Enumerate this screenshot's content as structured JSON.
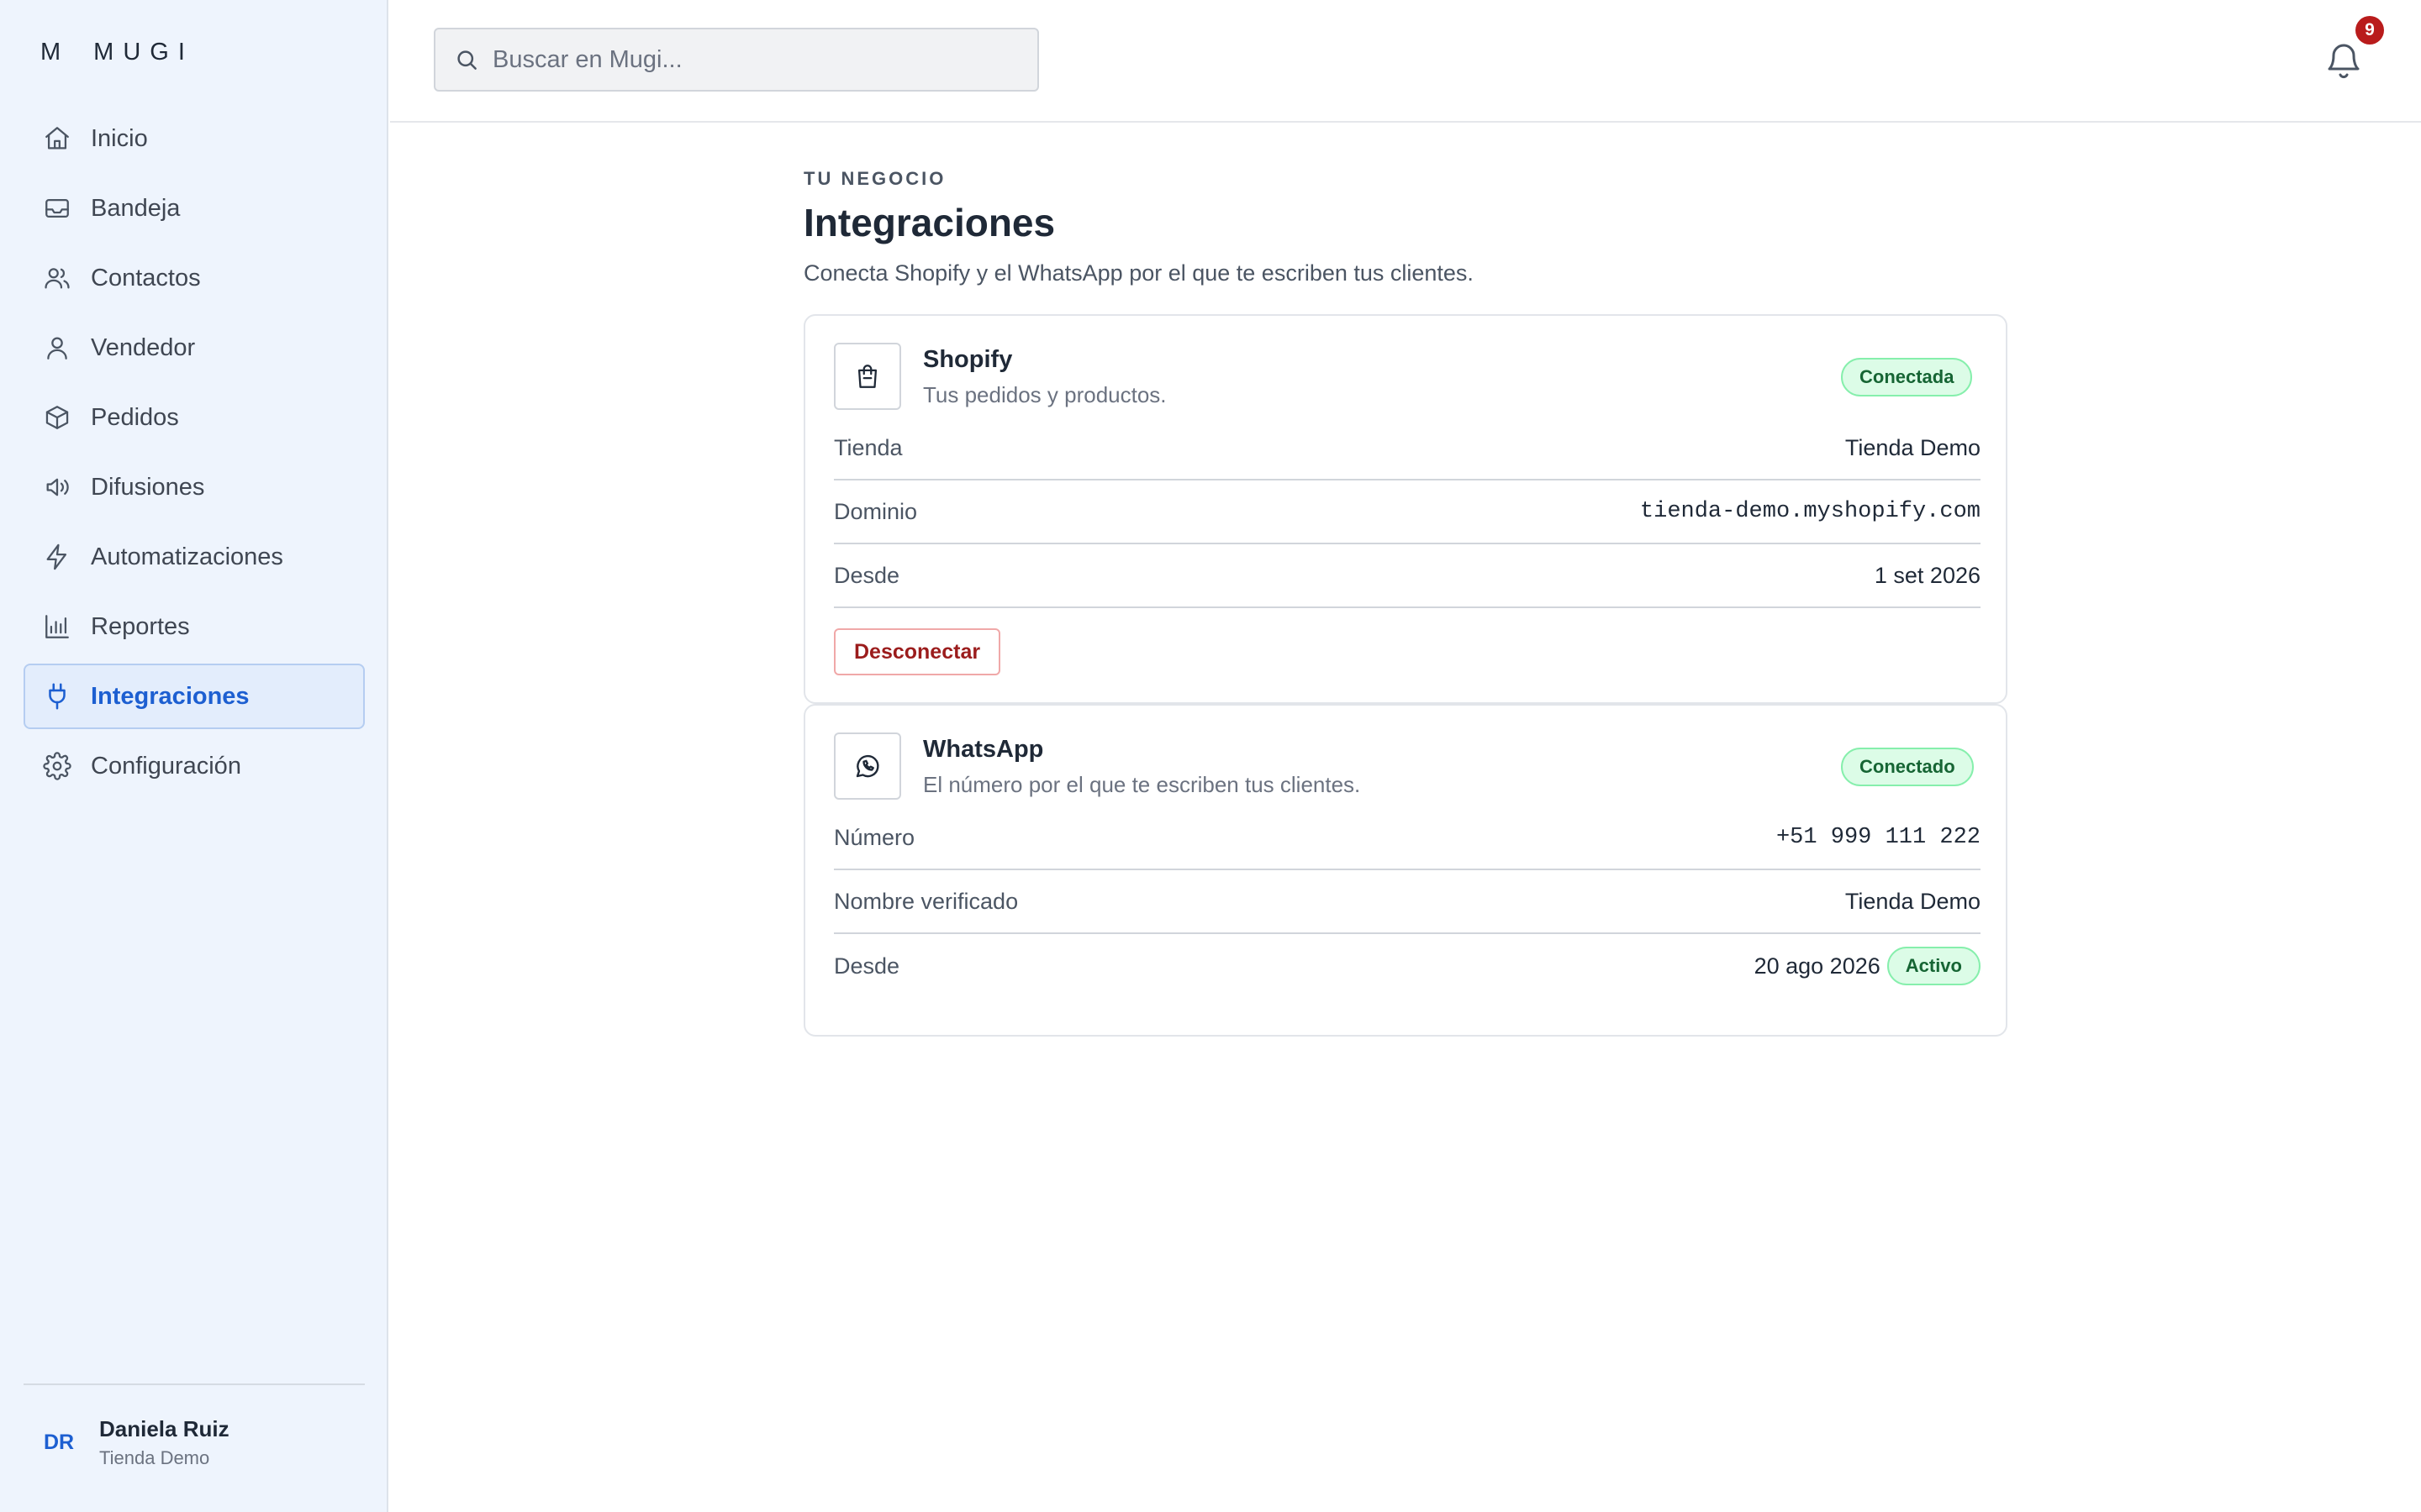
{
  "brand": {
    "logo_letter": "M",
    "logo_name": "MUGI"
  },
  "search": {
    "placeholder": "Buscar en Mugi...",
    "icon": "search-icon"
  },
  "notifications": {
    "count": "9",
    "icon": "bell-icon"
  },
  "sidebar": {
    "items": [
      {
        "label": "Inicio",
        "icon": "home-icon"
      },
      {
        "label": "Bandeja",
        "icon": "inbox-icon"
      },
      {
        "label": "Contactos",
        "icon": "users-icon"
      },
      {
        "label": "Vendedor",
        "icon": "user-icon"
      },
      {
        "label": "Pedidos",
        "icon": "package-icon"
      },
      {
        "label": "Difusiones",
        "icon": "megaphone-icon"
      },
      {
        "label": "Automatizaciones",
        "icon": "lightning-icon"
      },
      {
        "label": "Reportes",
        "icon": "bar-chart-icon"
      },
      {
        "label": "Integraciones",
        "icon": "plug-icon",
        "active": true
      },
      {
        "label": "Configuración",
        "icon": "gear-icon"
      }
    ],
    "user": {
      "initials": "DR",
      "name": "Daniela Ruiz",
      "shop": "Tienda Demo"
    }
  },
  "page": {
    "eyebrow": "TU NEGOCIO",
    "title": "Integraciones",
    "description": "Conecta Shopify y el WhatsApp por el que te escriben tus clientes."
  },
  "shopify": {
    "title": "Shopify",
    "subtitle": "Tus pedidos y productos.",
    "status": "Conectada",
    "rows": [
      {
        "key": "Tienda",
        "value": "Tienda Demo"
      },
      {
        "key": "Dominio",
        "value": "tienda-demo.myshopify.com"
      },
      {
        "key": "Desde",
        "value": "1 set 2026"
      }
    ],
    "disconnect_label": "Desconectar"
  },
  "whatsapp": {
    "title": "WhatsApp",
    "subtitle": "El número por el que te escriben tus clientes.",
    "status": "Conectado",
    "rows": [
      {
        "key": "Número",
        "value": "+51 999 111 222"
      },
      {
        "key": "Nombre verificado",
        "value": "Tienda Demo"
      },
      {
        "key": "Desde",
        "value": "20 ago 2026",
        "badge": "Activo"
      }
    ]
  },
  "colors": {
    "accent": "#1d5fd1",
    "success_bg": "#dcfce7",
    "success_text": "#166534",
    "danger": "#9b1c1c",
    "badge_red": "#b91c1c"
  }
}
